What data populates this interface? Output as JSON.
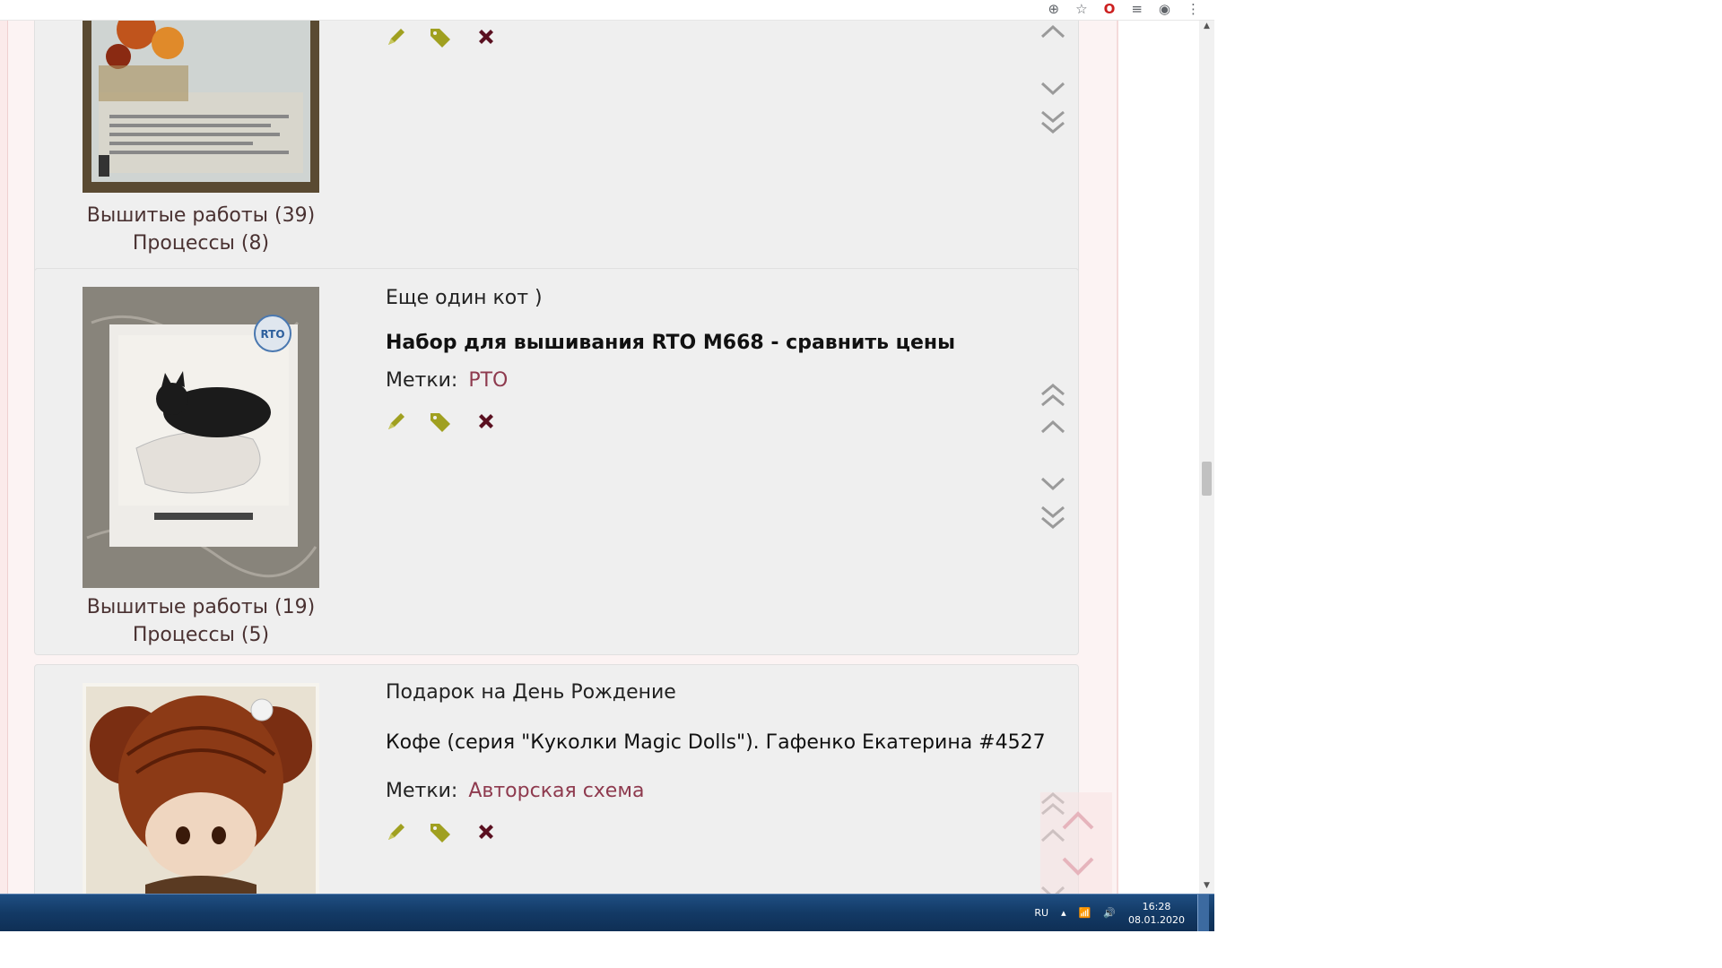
{
  "browser": {
    "icons": [
      "zoom-icon",
      "star-icon",
      "opera-icon",
      "playlist-icon",
      "profile-icon",
      "menu-icon"
    ]
  },
  "cards": [
    {
      "counts": {
        "works": "Вышитые работы (39)",
        "processes": "Процессы (8)"
      }
    },
    {
      "title": "Еще один кот )",
      "subtitle": "Набор для вышивания RTO M668 - сравнить цены",
      "tags_label": "Метки:",
      "tag": "РТО",
      "counts": {
        "works": "Вышитые работы (19)",
        "processes": "Процессы (5)"
      },
      "thumb_logo": "RTO"
    },
    {
      "title": "Подарок на День Рождение",
      "subtitle": "Кофе (серия \"Куколки Magic Dolls\"). Гафенко Екатерина #4527",
      "tags_label": "Метки:",
      "tag": "Авторская схема"
    }
  ],
  "taskbar": {
    "language": "RU",
    "time": "16:28",
    "date": "08.01.2020"
  },
  "colors": {
    "accent_tag": "#8e3a4e",
    "edit_icon": "#a0a020",
    "tag_icon": "#a0a020",
    "delete_icon": "#5a1020",
    "arrow": "#9a9a9a"
  }
}
